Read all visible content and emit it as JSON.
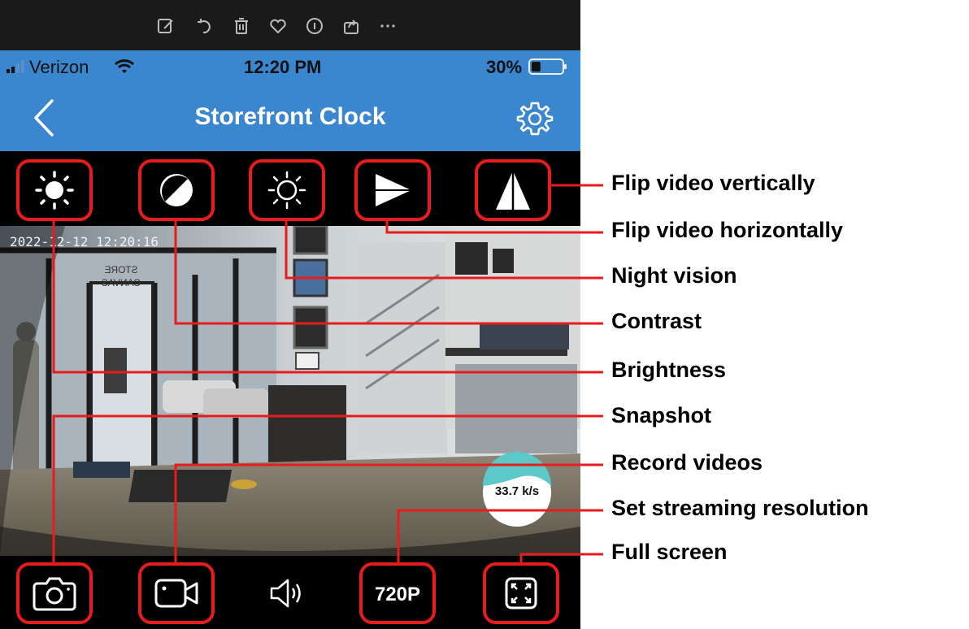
{
  "status_bar": {
    "carrier": "Verizon",
    "time": "12:20 PM",
    "battery": "30%",
    "battery_level": 0.3
  },
  "nav": {
    "title": "Storefront Clock",
    "back_icon": "chevron-left-icon",
    "settings_icon": "gear-icon"
  },
  "photo_toolbar_icons": [
    "edit-icon",
    "rotate-icon",
    "trash-icon",
    "heart-icon",
    "info-icon",
    "share-icon",
    "more-icon"
  ],
  "video": {
    "timestamp": "2022-12-12 12:20:16",
    "speed": "33.7 k/s",
    "sign_text": "STORE CANVAS"
  },
  "top_controls": [
    {
      "id": "brightness",
      "icon": "sun-icon"
    },
    {
      "id": "contrast",
      "icon": "contrast-icon"
    },
    {
      "id": "night-vision",
      "icon": "sun-outline-icon"
    },
    {
      "id": "flip-horizontal",
      "icon": "flip-horizontal-icon"
    },
    {
      "id": "flip-vertical",
      "icon": "flip-vertical-icon"
    }
  ],
  "bottom_controls": {
    "snapshot_icon": "camera-icon",
    "record_icon": "video-camera-icon",
    "audio_icon": "speaker-icon",
    "resolution": "720P",
    "fullscreen_icon": "fullscreen-icon"
  },
  "annotations": {
    "flip_vertical": "Flip video vertically",
    "flip_horizontal": "Flip video horizontally",
    "night_vision": "Night vision",
    "contrast": "Contrast",
    "brightness": "Brightness",
    "snapshot": "Snapshot",
    "record": "Record videos",
    "resolution": "Set streaming resolution",
    "fullscreen": "Full screen"
  },
  "colors": {
    "accent_blue": "#3a86cf",
    "callout_red": "#e81c1c",
    "speed_badge_teal": "#5bc8c9"
  }
}
